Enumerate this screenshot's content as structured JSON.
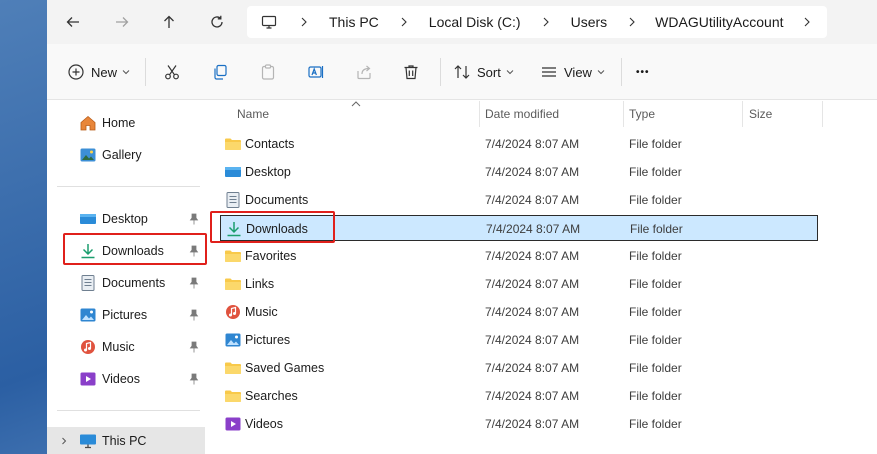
{
  "address_bar": {
    "back_icon": "arrow-left-icon",
    "forward_icon": "arrow-right-icon",
    "up_icon": "arrow-up-icon",
    "refresh_icon": "refresh-icon",
    "location_icon": "monitor-icon",
    "breadcrumbs": [
      "This PC",
      "Local Disk (C:)",
      "Users",
      "WDAGUtilityAccount"
    ]
  },
  "toolbar": {
    "new_label": "New",
    "sort_label": "Sort",
    "view_label": "View",
    "more_label": "•••"
  },
  "nav": {
    "top_items": [
      {
        "label": "Home",
        "icon": "home-icon"
      },
      {
        "label": "Gallery",
        "icon": "gallery-icon"
      }
    ],
    "quick_access": [
      {
        "label": "Desktop",
        "icon": "desktop-folder-icon"
      },
      {
        "label": "Downloads",
        "icon": "download-icon"
      },
      {
        "label": "Documents",
        "icon": "documents-icon"
      },
      {
        "label": "Pictures",
        "icon": "pictures-icon"
      },
      {
        "label": "Music",
        "icon": "music-icon"
      },
      {
        "label": "Videos",
        "icon": "videos-icon"
      }
    ],
    "this_pc_label": "This PC"
  },
  "columns": {
    "name": "Name",
    "date_modified": "Date modified",
    "type": "Type",
    "size": "Size"
  },
  "files": [
    {
      "name": "Contacts",
      "date": "7/4/2024 8:07 AM",
      "type": "File folder",
      "icon": "folder-icon"
    },
    {
      "name": "Desktop",
      "date": "7/4/2024 8:07 AM",
      "type": "File folder",
      "icon": "desktop-folder-icon"
    },
    {
      "name": "Documents",
      "date": "7/4/2024 8:07 AM",
      "type": "File folder",
      "icon": "documents-icon"
    },
    {
      "name": "Downloads",
      "date": "7/4/2024 8:07 AM",
      "type": "File folder",
      "icon": "download-icon"
    },
    {
      "name": "Favorites",
      "date": "7/4/2024 8:07 AM",
      "type": "File folder",
      "icon": "folder-icon"
    },
    {
      "name": "Links",
      "date": "7/4/2024 8:07 AM",
      "type": "File folder",
      "icon": "folder-icon"
    },
    {
      "name": "Music",
      "date": "7/4/2024 8:07 AM",
      "type": "File folder",
      "icon": "music-icon"
    },
    {
      "name": "Pictures",
      "date": "7/4/2024 8:07 AM",
      "type": "File folder",
      "icon": "pictures-icon"
    },
    {
      "name": "Saved Games",
      "date": "7/4/2024 8:07 AM",
      "type": "File folder",
      "icon": "folder-icon"
    },
    {
      "name": "Searches",
      "date": "7/4/2024 8:07 AM",
      "type": "File folder",
      "icon": "folder-icon"
    },
    {
      "name": "Videos",
      "date": "7/4/2024 8:07 AM",
      "type": "File folder",
      "icon": "videos-icon"
    }
  ],
  "colors": {
    "selection": "#cce8ff",
    "highlight": "#e0201b",
    "folder": "#f8c94a",
    "download_accent": "#1b9e6e"
  }
}
